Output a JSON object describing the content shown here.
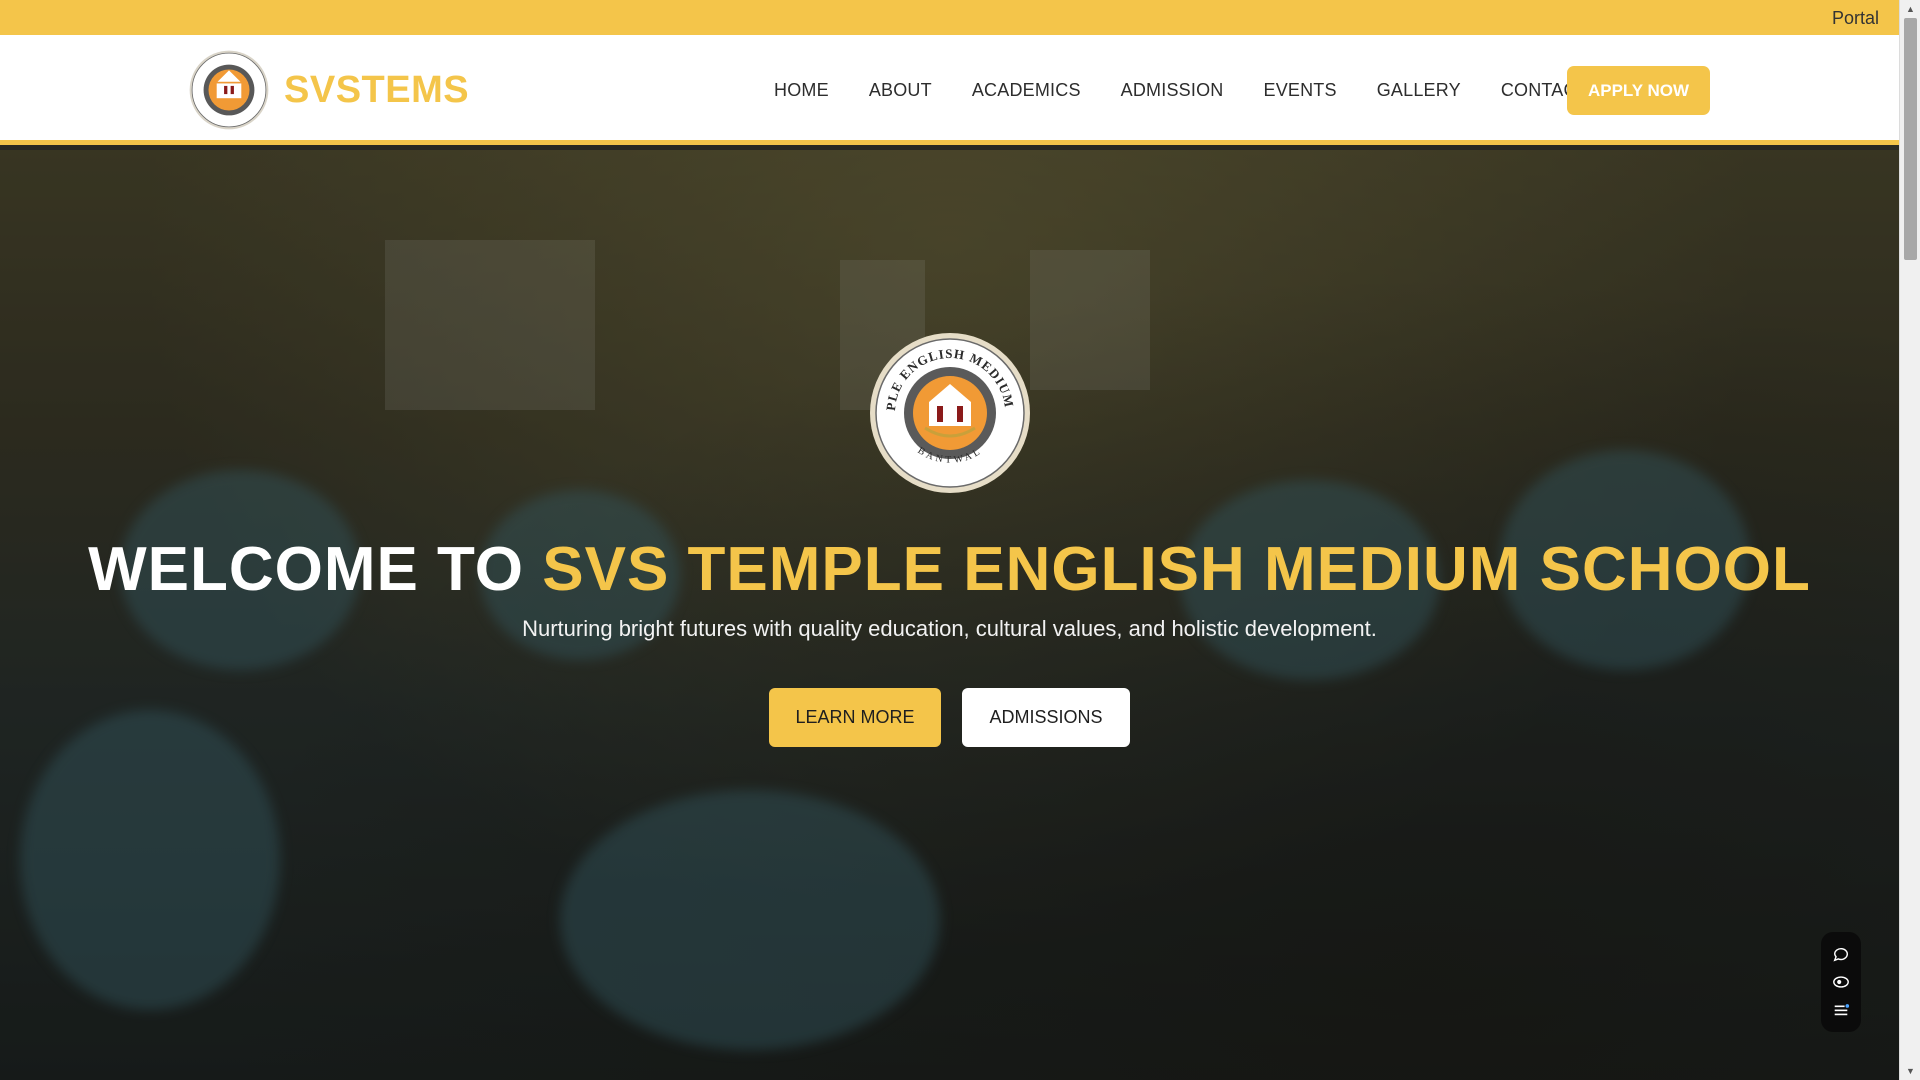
{
  "topbar": {
    "portal_label": "Portal"
  },
  "header": {
    "brand_name": "SVSTEMS",
    "logo_icon": "school-emblem-icon",
    "nav": [
      {
        "label": "HOME"
      },
      {
        "label": "ABOUT"
      },
      {
        "label": "ACADEMICS"
      },
      {
        "label": "ADMISSION"
      },
      {
        "label": "EVENTS"
      },
      {
        "label": "GALLERY"
      },
      {
        "label": "CONTACT"
      }
    ],
    "apply_label": "APPLY NOW"
  },
  "hero": {
    "emblem": {
      "top_text": "SVS TEMPLE ENGLISH MEDIUM SCHOOL",
      "bottom_text": "BANTWAL"
    },
    "title_prefix": "WELCOME TO ",
    "title_accent": "SVS TEMPLE ENGLISH MEDIUM SCHOOL",
    "subtitle": "Nurturing bright futures with quality education, cultural values, and holistic development.",
    "learn_more_label": "LEARN MORE",
    "admissions_label": "ADMISSIONS"
  },
  "widget": {
    "icons": [
      "chat-icon",
      "eye-icon",
      "list-icon"
    ]
  },
  "colors": {
    "accent": "#f4c54a",
    "header_bg": "#ffffff",
    "widget_bg": "#0b0b0b"
  }
}
